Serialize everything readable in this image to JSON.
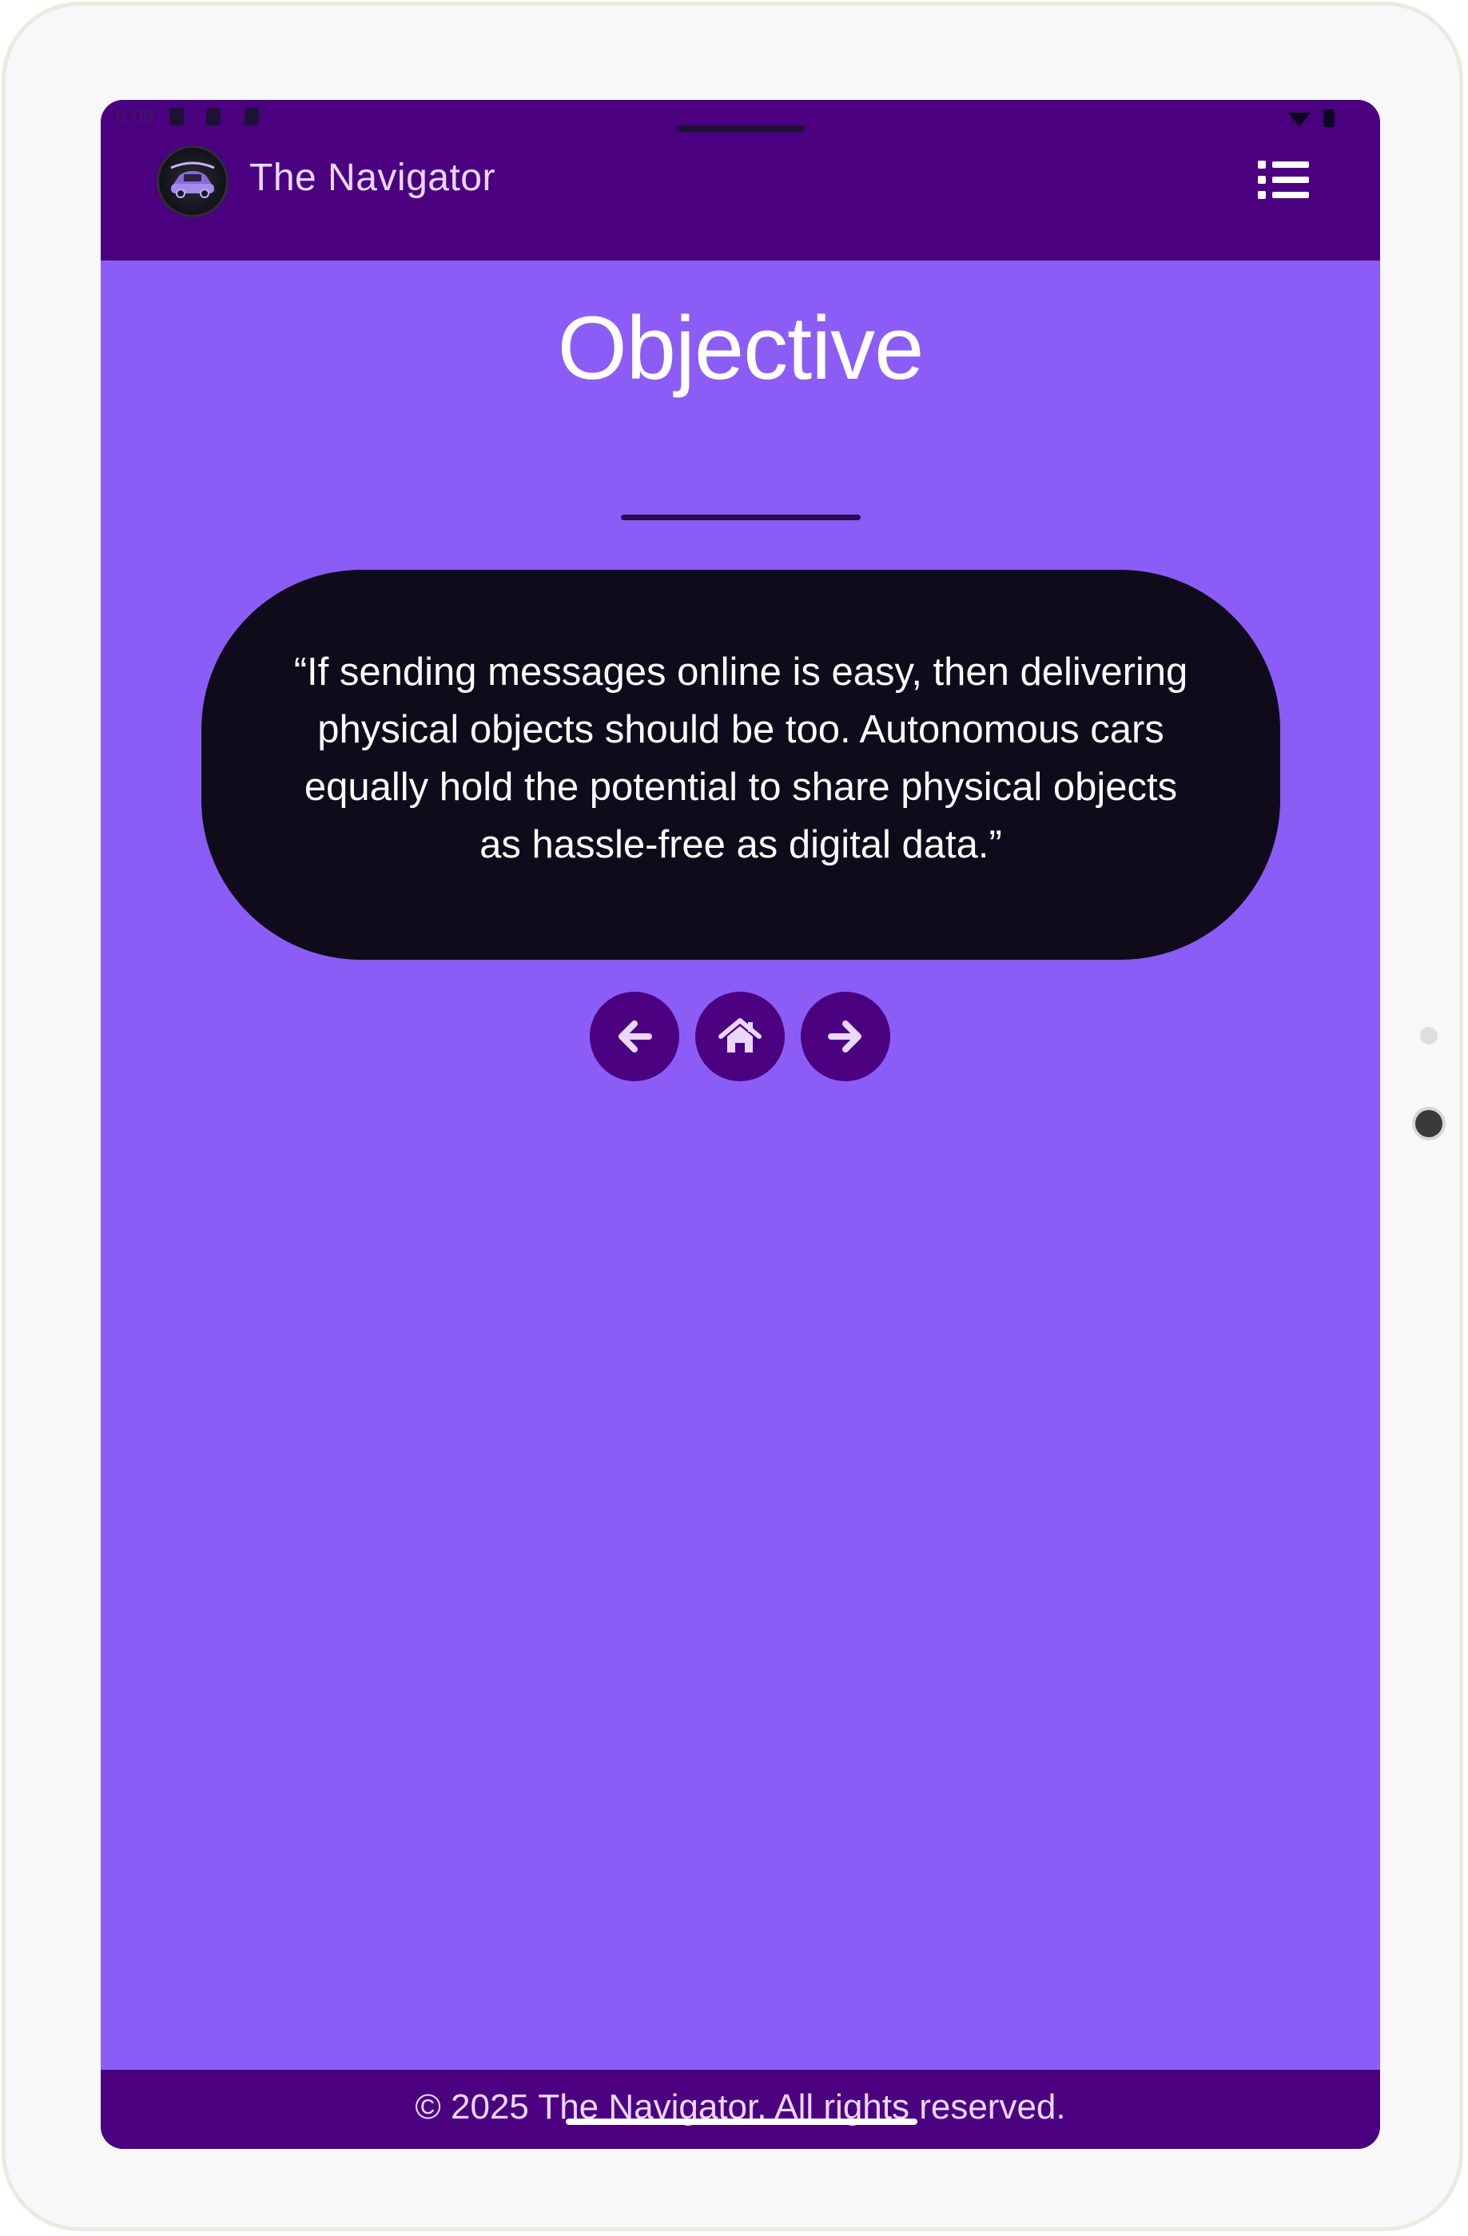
{
  "status_bar": {
    "time": "6:09"
  },
  "header": {
    "brand": "The Navigator",
    "logo_icon": "car-logo-icon",
    "menu_icon": "list-menu-icon"
  },
  "main": {
    "title": "Objective",
    "quote": "“If sending messages online is easy, then delivering physical objects should be too. Autonomous cars equally hold the potential to share physical objects as hassle-free as digital data.”",
    "nav": {
      "back_icon": "arrow-left-icon",
      "home_icon": "home-icon",
      "next_icon": "arrow-right-icon"
    }
  },
  "footer": {
    "text": "© 2025 The Navigator. All rights reserved."
  },
  "colors": {
    "navbar": "#4b0080",
    "background": "#8b5cf6",
    "card": "#0f0b1a",
    "accent_text": "#ead8ff"
  }
}
